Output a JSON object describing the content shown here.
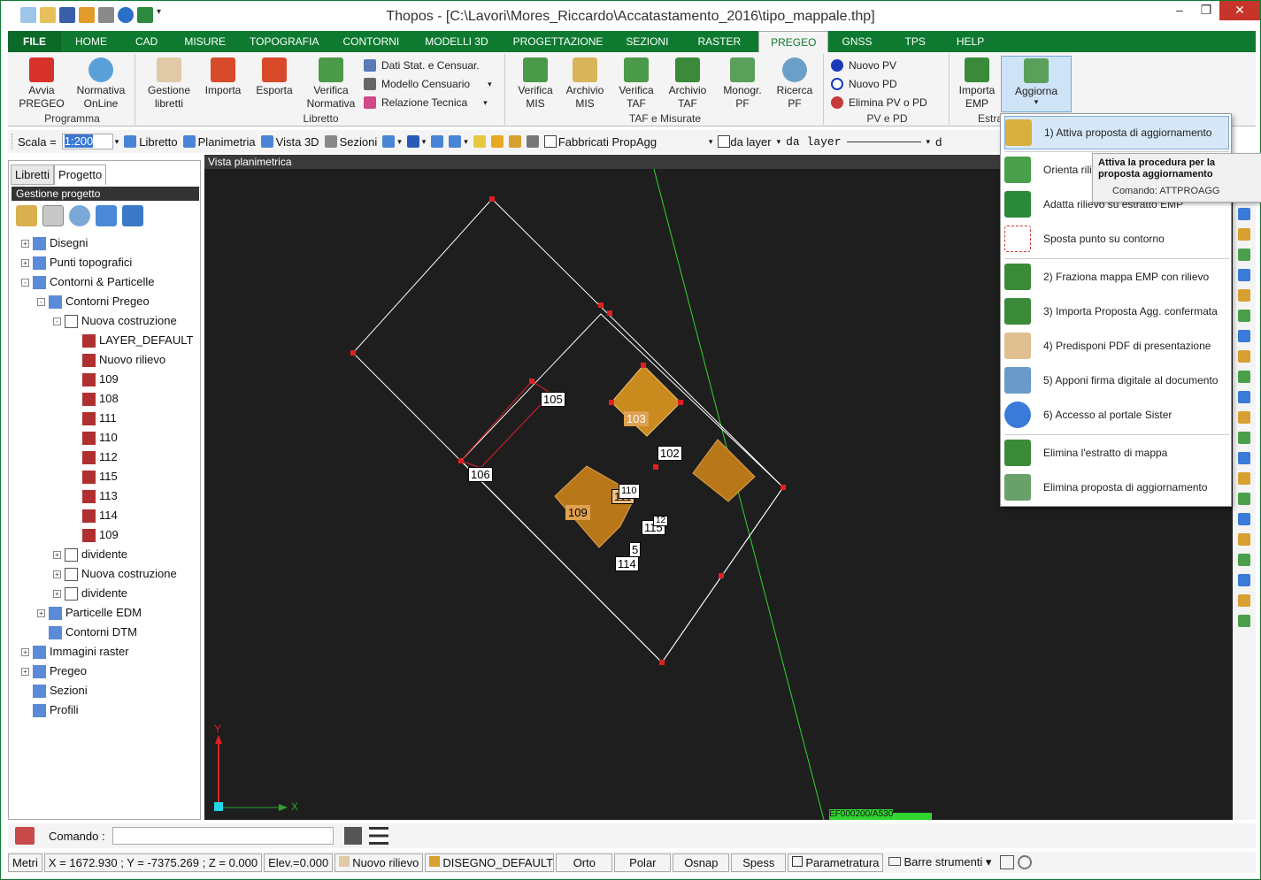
{
  "window": {
    "title": "Thopos - [C:\\Lavori\\Mores_Riccardo\\Accatastamento_2016\\tipo_mappale.thp]"
  },
  "tabs": [
    "FILE",
    "HOME",
    "CAD",
    "MISURE",
    "TOPOGRAFIA",
    "CONTORNI",
    "MODELLI 3D",
    "PROGETTAZIONE",
    "SEZIONI",
    "RASTER",
    "PREGEO",
    "GNSS",
    "TPS",
    "HELP"
  ],
  "ribbon": {
    "groups": {
      "programma": "Programma",
      "libretto": "Libretto",
      "taf": "TAF e Misurate",
      "pvpd": "PV e PD",
      "estratti": "Estrat"
    },
    "avvia": "Avvia PREGEO",
    "normativa": "Normativa OnLine",
    "gestione": "Gestione libretti",
    "importa": "Importa",
    "esporta": "Esporta",
    "verifica_norm": "Verifica Normativa",
    "dati_stat": "Dati Stat. e Censuar.",
    "modello": "Modello Censuario",
    "relazione": "Relazione Tecnica",
    "verifica_mis": "Verifica MIS",
    "archivio_mis": "Archivio MIS",
    "verifica_taf": "Verifica TAF",
    "archivio_taf": "Archivio TAF",
    "monogr": "Monogr. PF",
    "ricerca": "Ricerca PF",
    "nuovo_pv": "Nuovo PV",
    "nuovo_pd": "Nuovo PD",
    "elimina_pv": "Elimina PV o PD",
    "importa_emp": "Importa EMP",
    "aggiorna": "Aggiorna"
  },
  "toolbar": {
    "scala_label": "Scala =",
    "scala_value": "1:200",
    "libretto": "Libretto",
    "planimetria": "Planimetria",
    "vista3d": "Vista 3D",
    "sezioni": "Sezioni",
    "layer": "Fabbricati PropAgg",
    "da_layer": "da layer",
    "da_layer2": "da layer",
    "cut": "d"
  },
  "panel": {
    "tab_libretti": "Libretti",
    "tab_progetto": "Progetto",
    "header": "Gestione progetto",
    "tree": [
      {
        "label": "Disegni",
        "lvl": 0,
        "exp": "+"
      },
      {
        "label": "Punti topografici",
        "lvl": 0,
        "exp": "+"
      },
      {
        "label": "Contorni & Particelle",
        "lvl": 0,
        "exp": "-"
      },
      {
        "label": "Contorni Pregeo",
        "lvl": 1,
        "exp": "-"
      },
      {
        "label": "Nuova costruzione",
        "lvl": 2,
        "exp": "-"
      },
      {
        "label": "LAYER_DEFAULT",
        "lvl": 3,
        "exp": ""
      },
      {
        "label": "Nuovo rilievo",
        "lvl": 3,
        "exp": ""
      },
      {
        "label": "109",
        "lvl": 3,
        "exp": ""
      },
      {
        "label": "108",
        "lvl": 3,
        "exp": ""
      },
      {
        "label": "111",
        "lvl": 3,
        "exp": ""
      },
      {
        "label": "110",
        "lvl": 3,
        "exp": ""
      },
      {
        "label": "112",
        "lvl": 3,
        "exp": ""
      },
      {
        "label": "115",
        "lvl": 3,
        "exp": ""
      },
      {
        "label": "113",
        "lvl": 3,
        "exp": ""
      },
      {
        "label": "114",
        "lvl": 3,
        "exp": ""
      },
      {
        "label": "109",
        "lvl": 3,
        "exp": ""
      },
      {
        "label": "dividente",
        "lvl": 2,
        "exp": "+"
      },
      {
        "label": "Nuova costruzione",
        "lvl": 2,
        "exp": "+"
      },
      {
        "label": "dividente",
        "lvl": 2,
        "exp": "+"
      },
      {
        "label": "Particelle EDM",
        "lvl": 1,
        "exp": "+"
      },
      {
        "label": "Contorni DTM",
        "lvl": 1,
        "exp": ""
      },
      {
        "label": "Immagini raster",
        "lvl": 0,
        "exp": "+"
      },
      {
        "label": "Pregeo",
        "lvl": 0,
        "exp": "+"
      },
      {
        "label": "Sezioni",
        "lvl": 0,
        "exp": ""
      },
      {
        "label": "Profili",
        "lvl": 0,
        "exp": ""
      }
    ]
  },
  "view": {
    "title": "Vista planimetrica",
    "labels": {
      "l105": "105",
      "l103": "103",
      "l102": "102",
      "l106": "106",
      "l109": "109",
      "l111": "111",
      "l110": "110",
      "l115": "115",
      "l5": "5",
      "l114": "114",
      "l12": "12",
      "axis_y": "Y",
      "axis_x": "X",
      "bottom": "EF000200/A530"
    }
  },
  "menu": {
    "items": [
      "1) Attiva proposta di aggiornamento",
      "Orienta rili",
      "Adatta rilievo su estratto EMP",
      "Sposta punto su contorno",
      "2) Fraziona mappa EMP con rilievo",
      "3) Importa Proposta Agg. confermata",
      "4) Predisponi PDF di presentazione",
      "5) Apponi firma digitale al documento",
      "6) Accesso al portale Sister",
      "Elimina l'estratto di mappa",
      "Elimina proposta di aggiornamento"
    ]
  },
  "tooltip": {
    "title": "Attiva la procedura per la proposta aggiornamento",
    "command": "Comando: ATTPROAGG"
  },
  "cmd": {
    "label": "Comando :"
  },
  "status": {
    "units": "Metri",
    "coords": "X = 1672.930 ; Y = -7375.269 ; Z = 0.000",
    "elev": "Elev.=0.000",
    "rilievo": "Nuovo rilievo",
    "disegno": "DISEGNO_DEFAULT",
    "orto": "Orto",
    "polar": "Polar",
    "osnap": "Osnap",
    "spess": "Spess",
    "param": "Parametratura",
    "barre": "Barre strumenti"
  },
  "colors": {
    "green": "#0e7a30",
    "canvas": "#1e1e1e",
    "orange": "#c98a1e",
    "highlight": "#d6e8f8"
  }
}
